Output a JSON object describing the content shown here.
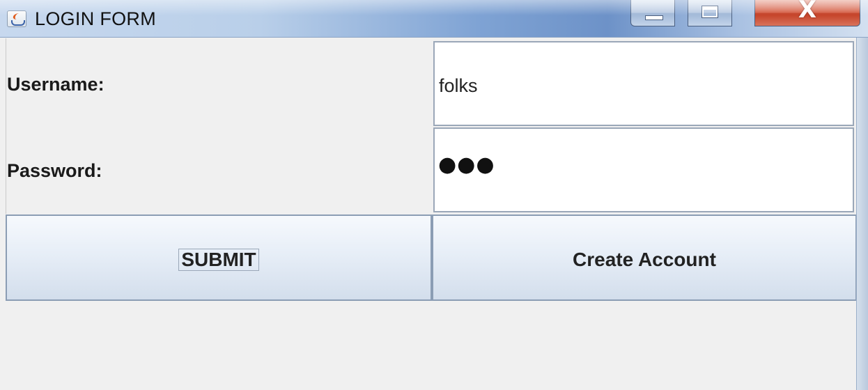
{
  "window": {
    "title": "LOGIN FORM",
    "icon": "java-cup-icon",
    "controls": {
      "minimize": "minimize-icon",
      "maximize": "maximize-icon",
      "close": "close-icon",
      "close_glyph": "X"
    }
  },
  "form": {
    "username_label": "Username:",
    "username_value": "folks",
    "password_label": "Password:",
    "password_mask": "●●●"
  },
  "buttons": {
    "submit_label": "SUBMIT",
    "create_label": "Create Account"
  },
  "colors": {
    "titlebar_accent": "#6d92c8",
    "close_button": "#c23c22",
    "panel_background": "#f0f0f0"
  }
}
